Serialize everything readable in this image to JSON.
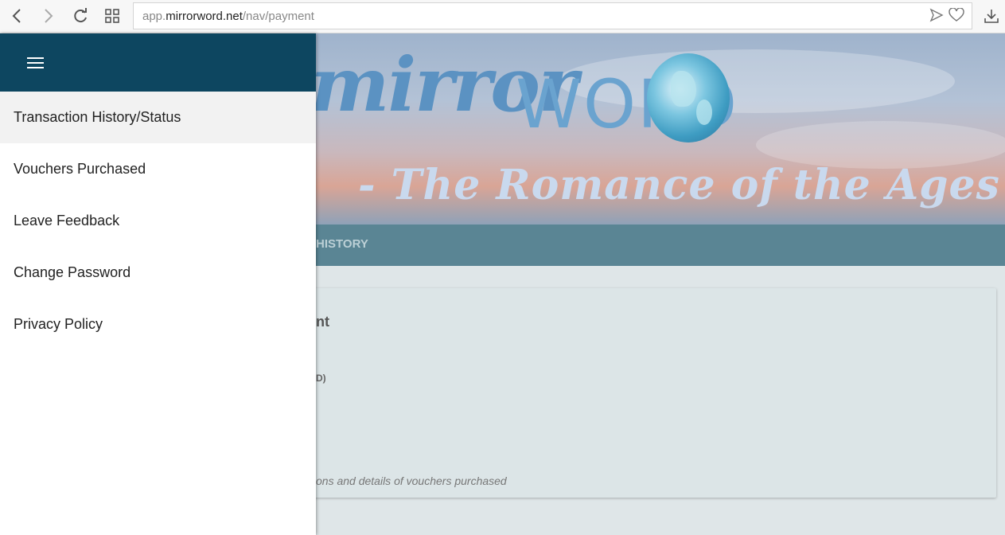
{
  "browser": {
    "url_prefix": "app.",
    "url_domain": "mirrorword.net",
    "url_path": "/nav/payment"
  },
  "banner": {
    "logo_script": "mirror",
    "logo_word": "WORD",
    "tagline": "- The Romance of the Ages -"
  },
  "nav_strip": {
    "label": "HISTORY"
  },
  "card": {
    "title_fragment": "nt",
    "subtitle_fragment": "D)",
    "note_fragment": "ons and details of vouchers purchased"
  },
  "drawer": {
    "menu_items": [
      {
        "label": "Transaction History/Status",
        "active": true
      },
      {
        "label": "Vouchers Purchased",
        "active": false
      },
      {
        "label": "Leave Feedback",
        "active": false
      },
      {
        "label": "Change Password",
        "active": false
      },
      {
        "label": "Privacy Policy",
        "active": false
      }
    ]
  },
  "colors": {
    "drawer_header": "#0d4660",
    "nav_strip": "#5a8594",
    "active_item_bg": "#f2f2f2"
  }
}
